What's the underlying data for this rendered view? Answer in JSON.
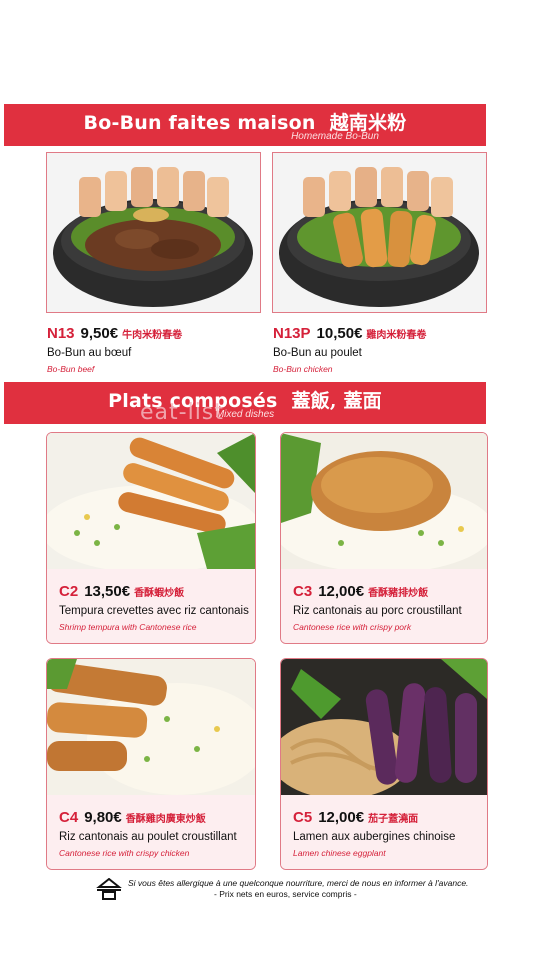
{
  "sections": [
    {
      "title": "Bo-Bun faites maison",
      "title_cn": "越南米粉",
      "subtitle": "Homemade Bo-Bun"
    },
    {
      "title": "Plats composés",
      "title_cn": "蓋飯, 蓋面",
      "subtitle": "Mixed dishes"
    }
  ],
  "watermark": "eat-list",
  "items": [
    {
      "code": "N13",
      "price": "9,50€",
      "cn": "牛肉米粉春卷",
      "fr": "Bo-Bun au bœuf",
      "en": "Bo-Bun beef"
    },
    {
      "code": "N13P",
      "price": "10,50€",
      "cn": "雞肉米粉春卷",
      "fr": "Bo-Bun au poulet",
      "en": "Bo-Bun chicken"
    },
    {
      "code": "C2",
      "price": "13,50€",
      "cn": "香酥蝦炒飯",
      "fr": "Tempura crevettes avec riz cantonais",
      "en": "Shrimp tempura with Cantonese rice"
    },
    {
      "code": "C3",
      "price": "12,00€",
      "cn": "香酥豬排炒飯",
      "fr": "Riz cantonais au porc croustillant",
      "en": "Cantonese rice with crispy pork"
    },
    {
      "code": "C4",
      "price": "9,80€",
      "cn": "香酥雞肉廣東炒飯",
      "fr": "Riz cantonais au poulet croustillant",
      "en": "Cantonese rice with crispy chicken"
    },
    {
      "code": "C5",
      "price": "12,00€",
      "cn": "茄子蓋澆面",
      "fr": "Lamen aux aubergines chinoise",
      "en": "Lamen chinese eggplant"
    }
  ],
  "footer": {
    "allergy_note": "Si vous êtes allergique à une quelconque nourriture, merci de nous en informer à l'avance.",
    "price_note": "- Prix nets en euros, service compris -",
    "icon": "allergen-icon"
  },
  "colors": {
    "accent": "#e0303f",
    "card_bg": "#fdeef0",
    "border": "#e07a86"
  }
}
